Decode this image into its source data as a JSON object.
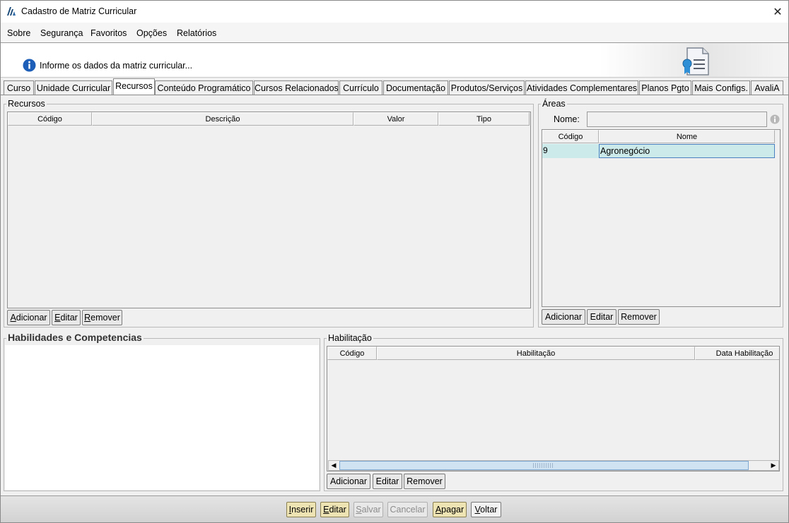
{
  "window": {
    "title": "Cadastro de Matriz Curricular",
    "close_symbol": "✕"
  },
  "menu": [
    "Sobre",
    "Segurança",
    "Favoritos",
    "Opções",
    "Relatórios"
  ],
  "banner": {
    "text": "Informe os dados da matriz curricular..."
  },
  "tabs": [
    "Curso",
    "Unidade Curricular",
    "Recursos",
    "Conteúdo Programático",
    "Cursos Relacionados",
    "Currículo",
    "Documentação",
    "Produtos/Serviços",
    "Atividades Complementares",
    "Planos Pgto",
    "Mais Configs.",
    "AvaliA"
  ],
  "active_tab": "Recursos",
  "recursos": {
    "title": "Recursos",
    "columns": [
      "Código",
      "Descrição",
      "Valor",
      "Tipo"
    ],
    "buttons": {
      "add": "Adicionar",
      "edit": "Editar",
      "remove": "Remover"
    }
  },
  "areas": {
    "title": "Áreas",
    "nome_label": "Nome:",
    "nome_value": "",
    "columns": [
      "Código",
      "Nome"
    ],
    "rows": [
      {
        "codigo": "9",
        "nome": "Agronegócio"
      }
    ],
    "buttons": {
      "add": "Adicionar",
      "edit": "Editar",
      "remove": "Remover"
    }
  },
  "habilidades": {
    "title": "Habilidades e Competencias"
  },
  "habilitacao": {
    "title": "Habilitação",
    "columns": [
      "Código",
      "Habilitação",
      "Data Habilitação"
    ],
    "buttons": {
      "add": "Adicionar",
      "edit": "Editar",
      "remove": "Remover"
    }
  },
  "footer": {
    "inserir": "Inserir",
    "editar": "Editar",
    "salvar": "Salvar",
    "cancelar": "Cancelar",
    "apagar": "Apagar",
    "voltar": "Voltar"
  },
  "colors": {
    "selection": "#cdeaea",
    "selection_border": "#4a7fc0",
    "button_yellow": "#eee3b2",
    "scroll_thumb": "#cfe3f3"
  },
  "icons": [
    "app-logo-icon",
    "close-icon",
    "info-icon",
    "certificate-icon",
    "info-circle-icon",
    "scroll-left-icon",
    "scroll-right-icon"
  ]
}
